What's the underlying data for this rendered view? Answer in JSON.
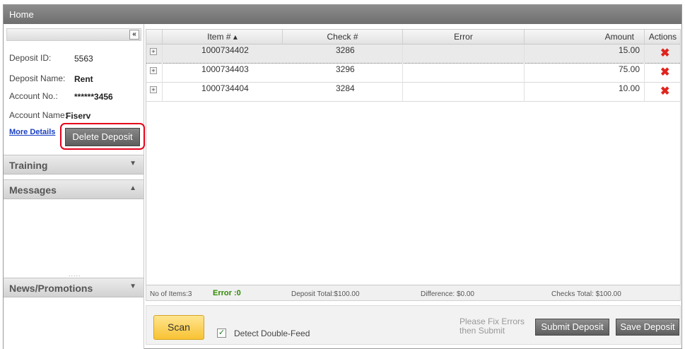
{
  "topbar": {
    "title": "Home"
  },
  "sidebar": {
    "collapse_label": "«",
    "fields": [
      {
        "label": "Deposit ID:",
        "value": "5563"
      },
      {
        "label": "Deposit Name:",
        "value": "Rent"
      },
      {
        "label": "Account No.:",
        "value": "******3456"
      },
      {
        "label": "Account Name:",
        "value": "Fiserv"
      }
    ],
    "more_details_label": "More Details",
    "delete_deposit_label": "Delete Deposit",
    "sections": [
      {
        "title": "Training",
        "arrow": "▼"
      },
      {
        "title": "Messages",
        "arrow": "▲"
      },
      {
        "title": "News/Promotions",
        "arrow": "▼"
      }
    ],
    "grip": "....."
  },
  "grid": {
    "columns": [
      "Item # ▴",
      "Check #",
      "Error",
      "Amount",
      "Actions"
    ],
    "expander_glyph": "+",
    "delete_glyph": "✖",
    "rows": [
      {
        "item": "1000734402",
        "check": "3286",
        "error": "",
        "amount": "15.00",
        "selected": true
      },
      {
        "item": "1000734403",
        "check": "3296",
        "error": "",
        "amount": "75.00",
        "selected": false
      },
      {
        "item": "1000734404",
        "check": "3284",
        "error": "",
        "amount": "10.00",
        "selected": false
      }
    ]
  },
  "totals": {
    "items": "No of Items:3",
    "error": "Error :0",
    "deposit_total": "Deposit Total:$100.00",
    "difference": "Difference: $0.00",
    "checks_total": "Checks Total: $100.00"
  },
  "actions": {
    "scan_label": "Scan",
    "detect_label": "Detect Double-Feed",
    "detect_checked": true,
    "check_glyph": "✓",
    "fix_note_line1": "Please Fix Errors",
    "fix_note_line2": "then Submit",
    "submit_label": "Submit Deposit",
    "save_label": "Save Deposit"
  },
  "colors": {
    "delete_x": "#e0241d",
    "error_ok": "#2e8b00",
    "highlight": "#e3001b",
    "scan_btn": "#f8c233"
  }
}
